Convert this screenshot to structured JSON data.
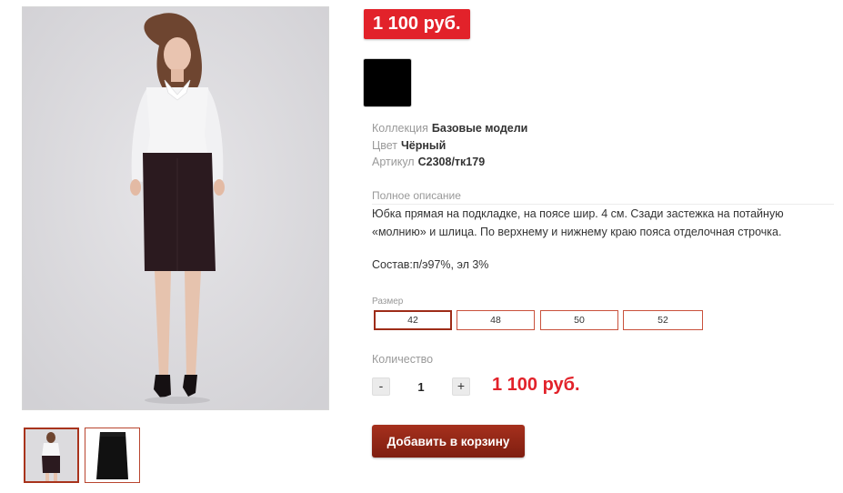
{
  "price_badge": "1 100 руб.",
  "color_swatch": {
    "color_hex": "#000000"
  },
  "properties": [
    {
      "label": "Коллекция",
      "value": "Базовые модели"
    },
    {
      "label": "Цвет",
      "value": "Чёрный"
    },
    {
      "label": "Артикул",
      "value": "С2308/тк179"
    }
  ],
  "description": {
    "title": "Полное описание",
    "text": "Юбка прямая на подкладке, на поясе шир. 4 см. Сзади застежка на потайную «молнию» и шлица. По верхнему и нижнему краю пояса отделочная строчка.",
    "composition": "Состав:п/э97%, эл 3%"
  },
  "sizes": {
    "label": "Размер",
    "options": [
      "42",
      "48",
      "50",
      "52"
    ],
    "selected": "42"
  },
  "quantity": {
    "label": "Количество",
    "minus": "-",
    "value": "1",
    "plus": "+"
  },
  "total_price": "1 100 руб.",
  "add_to_cart_label": "Добавить в корзину",
  "gallery": {
    "main_image": "model-in-white-shirt-and-black-skirt",
    "thumbnails": [
      "model-in-white-shirt-and-black-skirt",
      "black-pencil-skirt"
    ]
  },
  "colors": {
    "accent_red": "#e2222a",
    "button_dark_red": "#8f2616",
    "border_red": "#c9513c"
  }
}
